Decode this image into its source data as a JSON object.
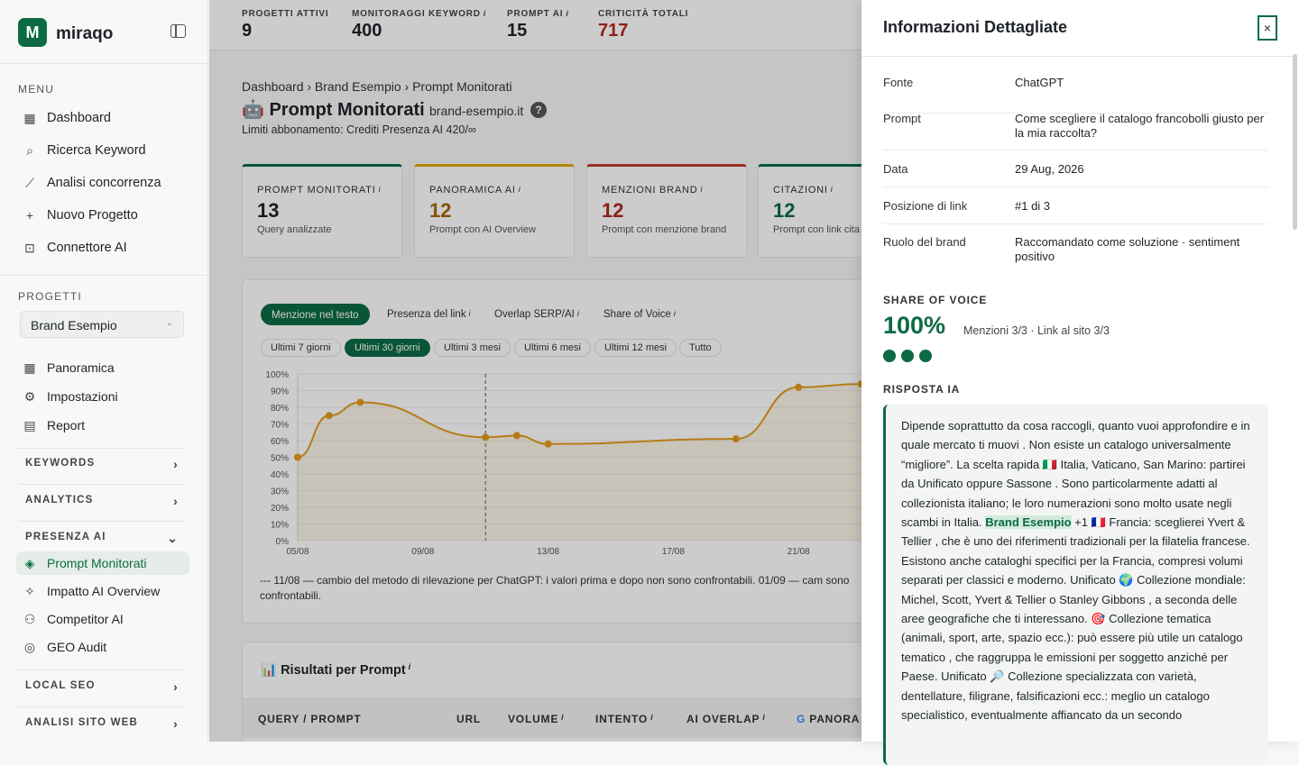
{
  "brand": {
    "logo_letter": "M",
    "name": "miraqo"
  },
  "sidebar": {
    "menu_heading": "MENU",
    "menu": [
      {
        "label": "Dashboard",
        "icon": "grid-icon"
      },
      {
        "label": "Ricerca Keyword",
        "icon": "search-icon"
      },
      {
        "label": "Analisi concorrenza",
        "icon": "chart-line-icon"
      },
      {
        "label": "Nuovo Progetto",
        "icon": "plus-icon"
      },
      {
        "label": "Connettore AI",
        "icon": "robot-icon"
      }
    ],
    "projects_heading": "PROGETTI",
    "project_select": "Brand Esempio",
    "project_items": [
      {
        "label": "Panoramica",
        "icon": "grid-icon"
      },
      {
        "label": "Impostazioni",
        "icon": "gear-icon"
      },
      {
        "label": "Report",
        "icon": "document-icon"
      }
    ],
    "groups": {
      "keywords": "KEYWORDS",
      "analytics": "ANALYTICS",
      "presenza_ai": "PRESENZA AI",
      "local_seo": "LOCAL SEO",
      "analisi_sito": "ANALISI SITO WEB"
    },
    "ai_items": [
      {
        "label": "Prompt Monitorati",
        "icon": "layers-icon"
      },
      {
        "label": "Impatto AI Overview",
        "icon": "sparkle-icon"
      },
      {
        "label": "Competitor AI",
        "icon": "users-icon"
      },
      {
        "label": "GEO Audit",
        "icon": "compass-icon"
      }
    ]
  },
  "topstats": [
    {
      "label": "PROGETTI ATTIVI",
      "value": "9",
      "color": "#1f2328",
      "info": ""
    },
    {
      "label": "MONITORAGGI KEYWORD",
      "value": "400",
      "color": "#1f2328",
      "info": "i"
    },
    {
      "label": "PROMPT AI",
      "value": "15",
      "color": "#1f2328",
      "info": "i"
    },
    {
      "label": "CRITICITÀ TOTALI",
      "value": "717",
      "color": "#b3261e",
      "info": ""
    }
  ],
  "page": {
    "breadcrumb": "Dashboard › Brand Esempio › Prompt Monitorati",
    "title": "🤖 Prompt Monitorati",
    "domain": "brand-esempio.it",
    "help": "?",
    "limits": "Limiti abbonamento: Crediti Presenza AI 420/∞"
  },
  "cards": [
    {
      "label": "PROMPT MONITORATI",
      "value": "13",
      "sub": "Query analizzate",
      "color": "#0c6b45",
      "valcolor": "#1f2328"
    },
    {
      "label": "PANORAMICA AI",
      "value": "12",
      "sub": "Prompt con AI Overview",
      "color": "#e0a800",
      "valcolor": "#a8660a"
    },
    {
      "label": "MENZIONI BRAND",
      "value": "12",
      "sub": "Prompt con menzione brand",
      "color": "#c0392b",
      "valcolor": "#b3261e"
    },
    {
      "label": "CITAZIONI",
      "value": "12",
      "sub": "Prompt con link cita",
      "color": "#0c6b45",
      "valcolor": "#0c6b45"
    }
  ],
  "metric_tabs": [
    "Menzione nel testo",
    "Presenza del link",
    "Overlap SERP/AI",
    "Share of Voice"
  ],
  "range_tabs": [
    "Ultimi 7 giorni",
    "Ultimi 30 giorni",
    "Ultimi 3 mesi",
    "Ultimi 6 mesi",
    "Ultimi 12 mesi",
    "Tutto"
  ],
  "chart_data": {
    "type": "line",
    "y_ticks": [
      "100%",
      "90%",
      "80%",
      "70%",
      "60%",
      "50%",
      "40%",
      "30%",
      "20%",
      "10%",
      "0%"
    ],
    "x_ticks": [
      "05/08",
      "09/08",
      "13/08",
      "17/08",
      "21/08"
    ],
    "ylim": [
      0,
      100
    ],
    "series": [
      {
        "color": "#e39b1c",
        "points": [
          [
            0,
            50
          ],
          [
            1,
            75
          ],
          [
            2,
            83
          ],
          [
            6,
            62
          ],
          [
            7,
            63
          ],
          [
            8,
            58
          ],
          [
            14,
            61
          ],
          [
            16,
            92
          ],
          [
            18,
            94
          ]
        ]
      }
    ],
    "annotation_day": 6
  },
  "chart_note": "--- 11/08 — cambio del metodo di rilevazione per ChatGPT: i valori prima e dopo non sono confrontabili. 01/09 — cam sono confrontabili.",
  "results": {
    "title": "📊 Risultati per Prompt",
    "columns": [
      "QUERY / PROMPT",
      "URL",
      "VOLUME",
      "INTENTO",
      "AI OVERLAP",
      "PANORA"
    ]
  },
  "drawer": {
    "title": "Informazioni Dettagliate",
    "close": "×",
    "rows": [
      {
        "key": "Fonte",
        "value": "ChatGPT"
      },
      {
        "key": "Prompt",
        "value": "Come scegliere il catalogo francobolli giusto per la mia raccolta?"
      },
      {
        "key": "Data",
        "value": "29 Aug, 2026"
      },
      {
        "key": "Posizione di link",
        "value": "#1 di 3"
      },
      {
        "key": "Ruolo del brand",
        "value": "Raccomandato come soluzione · sentiment positivo"
      }
    ],
    "sov_heading": "SHARE OF VOICE",
    "sov_value": "100%",
    "sov_sub": "Menzioni 3/3 · Link al sito 3/3",
    "answer_heading": "RISPOSTA IA",
    "answer_before": "Dipende soprattutto da cosa raccogli, quanto vuoi approfondire e in quale mercato ti muovi . Non esiste un catalogo universalmente “migliore”. La scelta rapida 🇮🇹 Italia, Vaticano, San Marino: partirei da Unificato oppure Sassone . Sono particolarmente adatti al collezionista italiano; le loro numerazioni sono molto usate negli scambi in Italia. ",
    "answer_highlight": "Brand Esempio",
    "answer_after": " +1 🇫🇷 Francia: sceglierei Yvert & Tellier , che è uno dei riferimenti tradizionali per la filatelia francese. Esistono anche cataloghi specifici per la Francia, compresi volumi separati per classici e moderno. Unificato 🌍 Collezione mondiale: Michel, Scott, Yvert & Tellier o Stanley Gibbons , a seconda delle aree geografiche che ti interessano. 🎯 Collezione tematica (animali, sport, arte, spazio ecc.): può essere più utile un catalogo tematico , che raggruppa le emissioni per soggetto anziché per Paese. Unificato 🔎 Collezione specializzata con varietà, dentellature, filigrane, falsificazioni ecc.: meglio un catalogo specialistico, eventualmente affiancato da un secondo"
  }
}
